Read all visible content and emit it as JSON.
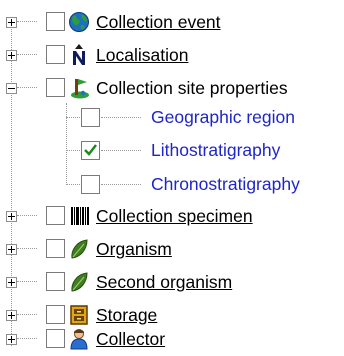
{
  "tree": {
    "nodes": [
      {
        "label": "Collection event",
        "icon": "globe-icon",
        "expander": "plus",
        "checked": false,
        "underlined": true
      },
      {
        "label": "Localisation",
        "icon": "north-arrow-icon",
        "expander": "plus",
        "checked": false,
        "underlined": true
      },
      {
        "label": "Collection site properties",
        "icon": "site-properties-icon",
        "expander": "minus",
        "checked": false,
        "underlined": false,
        "children": [
          {
            "label": "Geographic region",
            "checked": false
          },
          {
            "label": "Lithostratigraphy",
            "checked": true
          },
          {
            "label": "Chronostratigraphy",
            "checked": false
          }
        ]
      },
      {
        "label": "Collection specimen",
        "icon": "barcode-icon",
        "expander": "plus",
        "checked": false,
        "underlined": true
      },
      {
        "label": "Organism",
        "icon": "leaf-icon",
        "expander": "plus",
        "checked": false,
        "underlined": true
      },
      {
        "label": "Second organism",
        "icon": "leaf-icon",
        "expander": "plus",
        "checked": false,
        "underlined": true
      },
      {
        "label": "Storage",
        "icon": "storage-icon",
        "expander": "plus",
        "checked": false,
        "underlined": true
      },
      {
        "label": "Collector",
        "icon": "person-icon",
        "expander": "plus",
        "checked": false,
        "underlined": true
      }
    ]
  },
  "colors": {
    "child_label": "#1f26c9",
    "leaf": "#3f7d1e",
    "globe_ocean": "#1e6fc0",
    "globe_land": "#2e9e3a"
  }
}
